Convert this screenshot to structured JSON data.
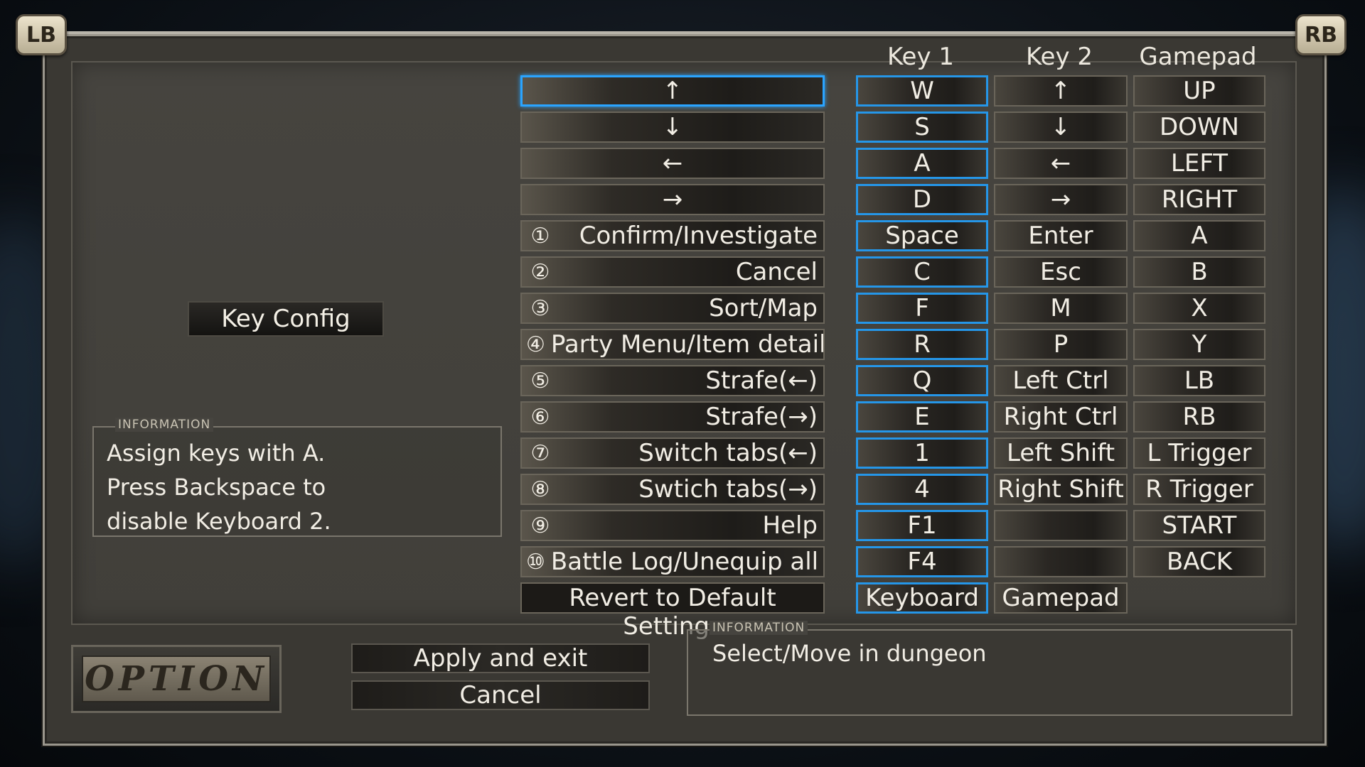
{
  "shoulders": {
    "left": "LB",
    "right": "RB"
  },
  "columns": {
    "key1": "Key 1",
    "key2": "Key 2",
    "gamepad": "Gamepad"
  },
  "left_button": "Key Config",
  "left_info": {
    "title": "INFORMATION",
    "lines": [
      "Assign keys with A.",
      "Press Backspace to",
      "disable Keyboard 2."
    ]
  },
  "actions": [
    {
      "num": "",
      "label": "↑",
      "key1": "W",
      "key2": "↑",
      "gamepad": "UP"
    },
    {
      "num": "",
      "label": "↓",
      "key1": "S",
      "key2": "↓",
      "gamepad": "DOWN"
    },
    {
      "num": "",
      "label": "←",
      "key1": "A",
      "key2": "←",
      "gamepad": "LEFT"
    },
    {
      "num": "",
      "label": "→",
      "key1": "D",
      "key2": "→",
      "gamepad": "RIGHT"
    },
    {
      "num": "①",
      "label": "Confirm/Investigate",
      "key1": "Space",
      "key2": "Enter",
      "gamepad": "A"
    },
    {
      "num": "②",
      "label": "Cancel",
      "key1": "C",
      "key2": "Esc",
      "gamepad": "B"
    },
    {
      "num": "③",
      "label": "Sort/Map",
      "key1": "F",
      "key2": "M",
      "gamepad": "X"
    },
    {
      "num": "④",
      "label": "Party Menu/Item detail",
      "key1": "R",
      "key2": "P",
      "gamepad": "Y"
    },
    {
      "num": "⑤",
      "label": "Strafe(←)",
      "key1": "Q",
      "key2": "Left Ctrl",
      "gamepad": "LB"
    },
    {
      "num": "⑥",
      "label": "Strafe(→)",
      "key1": "E",
      "key2": "Right Ctrl",
      "gamepad": "RB"
    },
    {
      "num": "⑦",
      "label": "Switch tabs(←)",
      "key1": "1",
      "key2": "Left Shift",
      "gamepad": "L Trigger"
    },
    {
      "num": "⑧",
      "label": "Swtich tabs(→)",
      "key1": "4",
      "key2": "Right Shift",
      "gamepad": "R Trigger"
    },
    {
      "num": "⑨",
      "label": "Help",
      "key1": "F1",
      "key2": "",
      "gamepad": "START"
    },
    {
      "num": "⑩",
      "label": "Battle Log/Unequip all",
      "key1": "F4",
      "key2": "",
      "gamepad": "BACK"
    }
  ],
  "revert_label": "Revert to Default Settings",
  "revert_keyboard": "Keyboard",
  "revert_gamepad": "Gamepad",
  "bottom_info": {
    "title": "INFORMATION",
    "text": "Select/Move in dungeon"
  },
  "option_label": "OPTION",
  "apply_label": "Apply and exit",
  "cancel_label": "Cancel",
  "accent_color": "#2aa4ff"
}
